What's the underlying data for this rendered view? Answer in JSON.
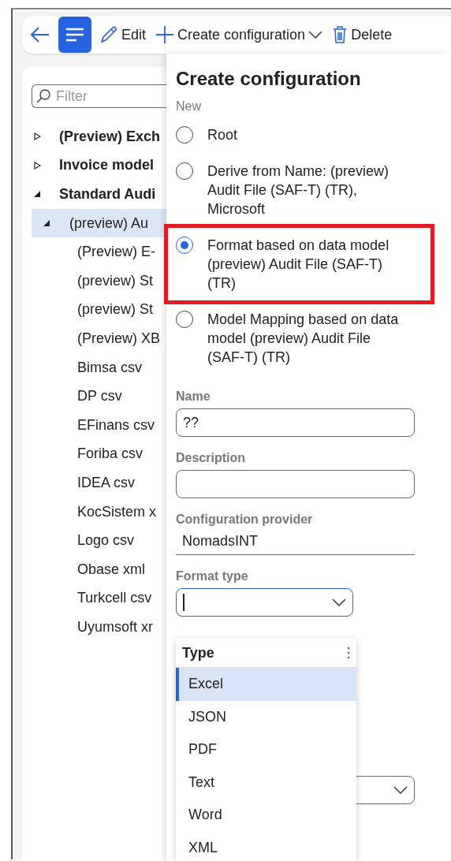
{
  "toolbar": {
    "items": [
      {
        "kind": "back",
        "selected": false
      },
      {
        "kind": "menu",
        "selected": true
      },
      {
        "kind": "edit",
        "label": "Edit",
        "selected": false
      },
      {
        "kind": "create",
        "label": "Create configuration",
        "selected": false
      },
      {
        "kind": "delete",
        "label": "Delete",
        "selected": false
      }
    ]
  },
  "filter": {
    "placeholder": "Filter"
  },
  "tree": [
    {
      "label": "(Preview) Exch",
      "expanded": false,
      "selected": false
    },
    {
      "label": "Invoice model",
      "expanded": false,
      "selected": false
    },
    {
      "label": "Standard Audi",
      "expanded": true,
      "selected": false,
      "children": [
        {
          "label": "(preview) Au",
          "expanded": true,
          "selected": true,
          "children": [
            {
              "label": "(Preview) E-",
              "selected": false
            },
            {
              "label": "(preview) St",
              "selected": false
            },
            {
              "label": "(preview) St",
              "selected": false
            },
            {
              "label": "(Preview) XB",
              "selected": false
            },
            {
              "label": "Bimsa csv",
              "selected": false
            },
            {
              "label": "DP csv",
              "selected": false
            },
            {
              "label": "EFinans csv",
              "selected": false
            },
            {
              "label": "Foriba csv",
              "selected": false
            },
            {
              "label": "IDEA csv",
              "selected": false
            },
            {
              "label": "KocSistem x",
              "selected": false
            },
            {
              "label": "Logo csv",
              "selected": false
            },
            {
              "label": "Obase xml",
              "selected": false
            },
            {
              "label": "Turkcell csv",
              "selected": false
            },
            {
              "label": "Uyumsoft xr",
              "selected": false
            }
          ]
        }
      ]
    }
  ],
  "panel": {
    "title": "Create configuration",
    "new_label": "New",
    "options": [
      {
        "label": "Root",
        "selected": false,
        "highlighted": false
      },
      {
        "label": "Derive from Name: (preview) Audit File (SAF-T) (TR), Microsoft",
        "selected": false,
        "highlighted": false
      },
      {
        "label": "Format based on data model (preview) Audit File (SAF-T) (TR)",
        "selected": true,
        "highlighted": true
      },
      {
        "label": "Model Mapping based on data model (preview) Audit File (SAF-T) (TR)",
        "selected": false,
        "highlighted": false
      }
    ],
    "name": {
      "label": "Name",
      "value": "??"
    },
    "description": {
      "label": "Description"
    },
    "provider": {
      "label": "Configuration provider",
      "value": "NomadsINT"
    },
    "format_type": {
      "label": "Format type",
      "focused": true,
      "dropdown": {
        "header": "Type",
        "options": [
          {
            "label": "Excel",
            "selected": true
          },
          {
            "label": "JSON",
            "selected": false
          },
          {
            "label": "PDF",
            "selected": false
          },
          {
            "label": "Text",
            "selected": false
          },
          {
            "label": "Word",
            "selected": false
          },
          {
            "label": "XML",
            "selected": false
          }
        ]
      }
    }
  }
}
